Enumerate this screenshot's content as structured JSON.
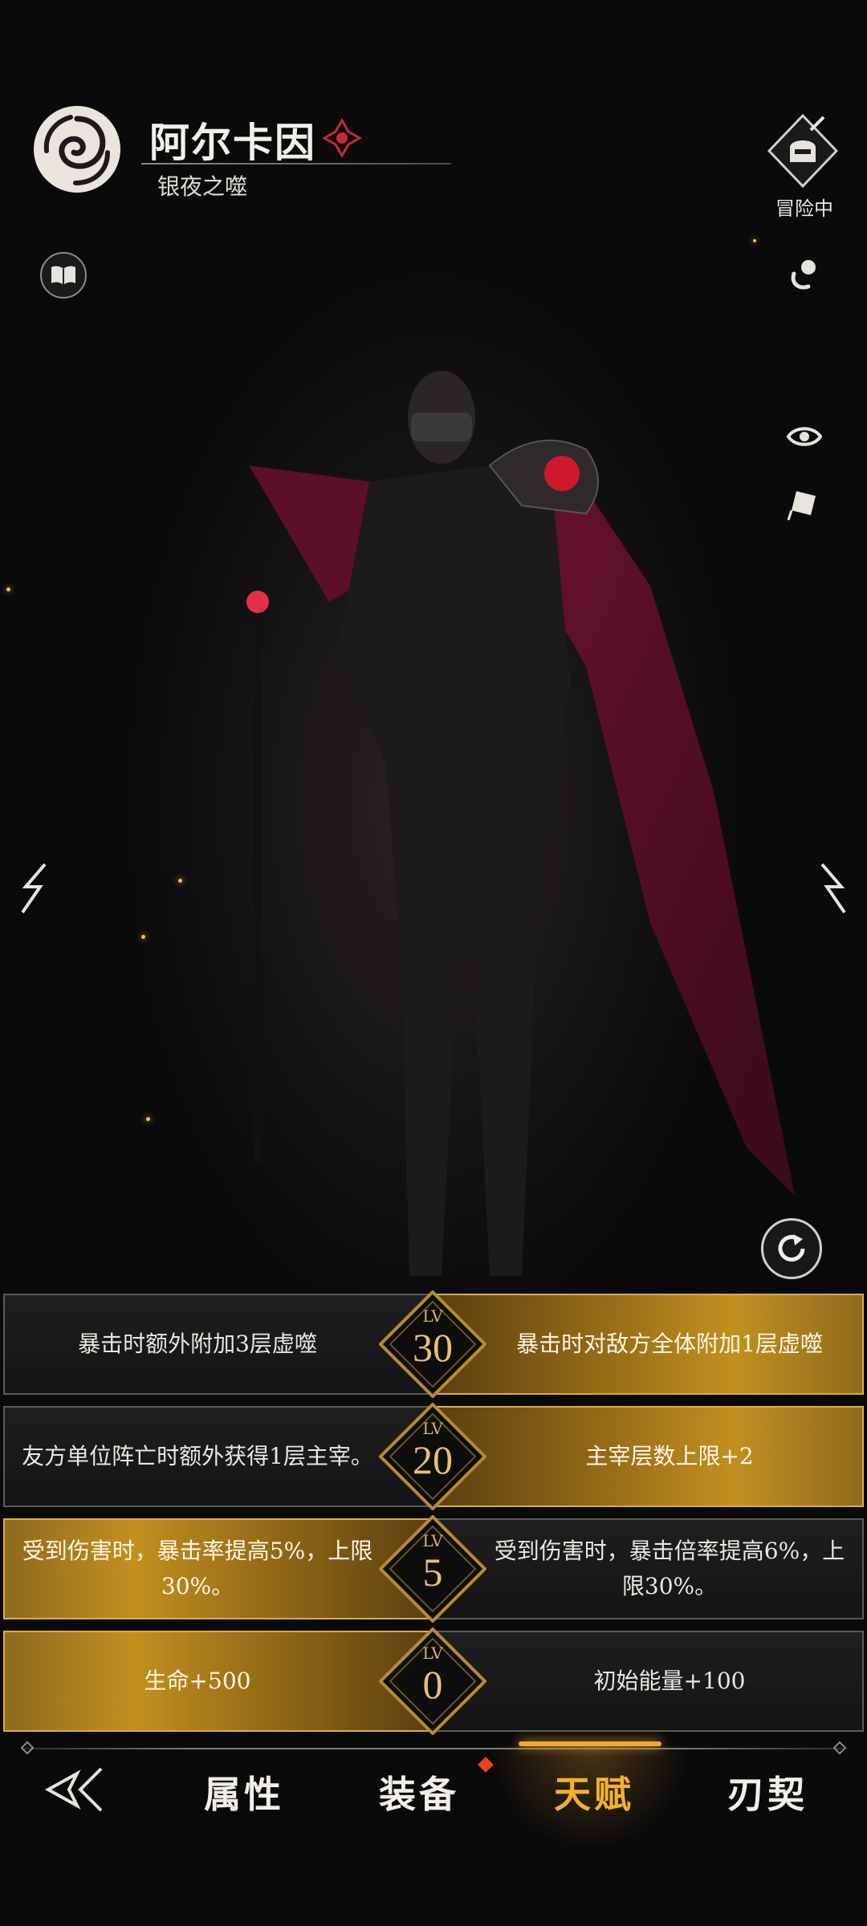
{
  "header": {
    "name": "阿尔卡因",
    "title": "银夜之噬",
    "status_label": "冒险中",
    "emblem_icon": "spiral-emblem-icon",
    "rune_icon": "crimson-rune-icon"
  },
  "side_buttons": {
    "book_icon": "book-icon",
    "adventure_icon": "helmet-sword-icon",
    "pose_icon": "pose-icon",
    "eye_icon": "eye-icon",
    "tag_icon": "tag-icon",
    "refresh_icon": "refresh-icon"
  },
  "talents": [
    {
      "level_label": "LV",
      "level": "30",
      "left": "暴击时额外附加3层虚噬",
      "right": "暴击时对敌方全体附加1层虚噬",
      "highlight": "right"
    },
    {
      "level_label": "LV",
      "level": "20",
      "left": "友方单位阵亡时额外获得1层主宰。",
      "right": "主宰层数上限+2",
      "highlight": "right"
    },
    {
      "level_label": "LV",
      "level": "5",
      "left": "受到伤害时，暴击率提高5%，上限30%。",
      "right": "受到伤害时，暴击倍率提高6%，上限30%。",
      "highlight": "left"
    },
    {
      "level_label": "LV",
      "level": "0",
      "left": "生命+500",
      "right": "初始能量+100",
      "highlight": "left"
    }
  ],
  "bottom_nav": {
    "tabs": [
      "属性",
      "装备",
      "天赋",
      "刃契"
    ],
    "active": "天赋"
  },
  "colors": {
    "gold_accent": "#f0b12e",
    "level_gold": "#e3c36c",
    "badge_red": "#e8451e"
  }
}
